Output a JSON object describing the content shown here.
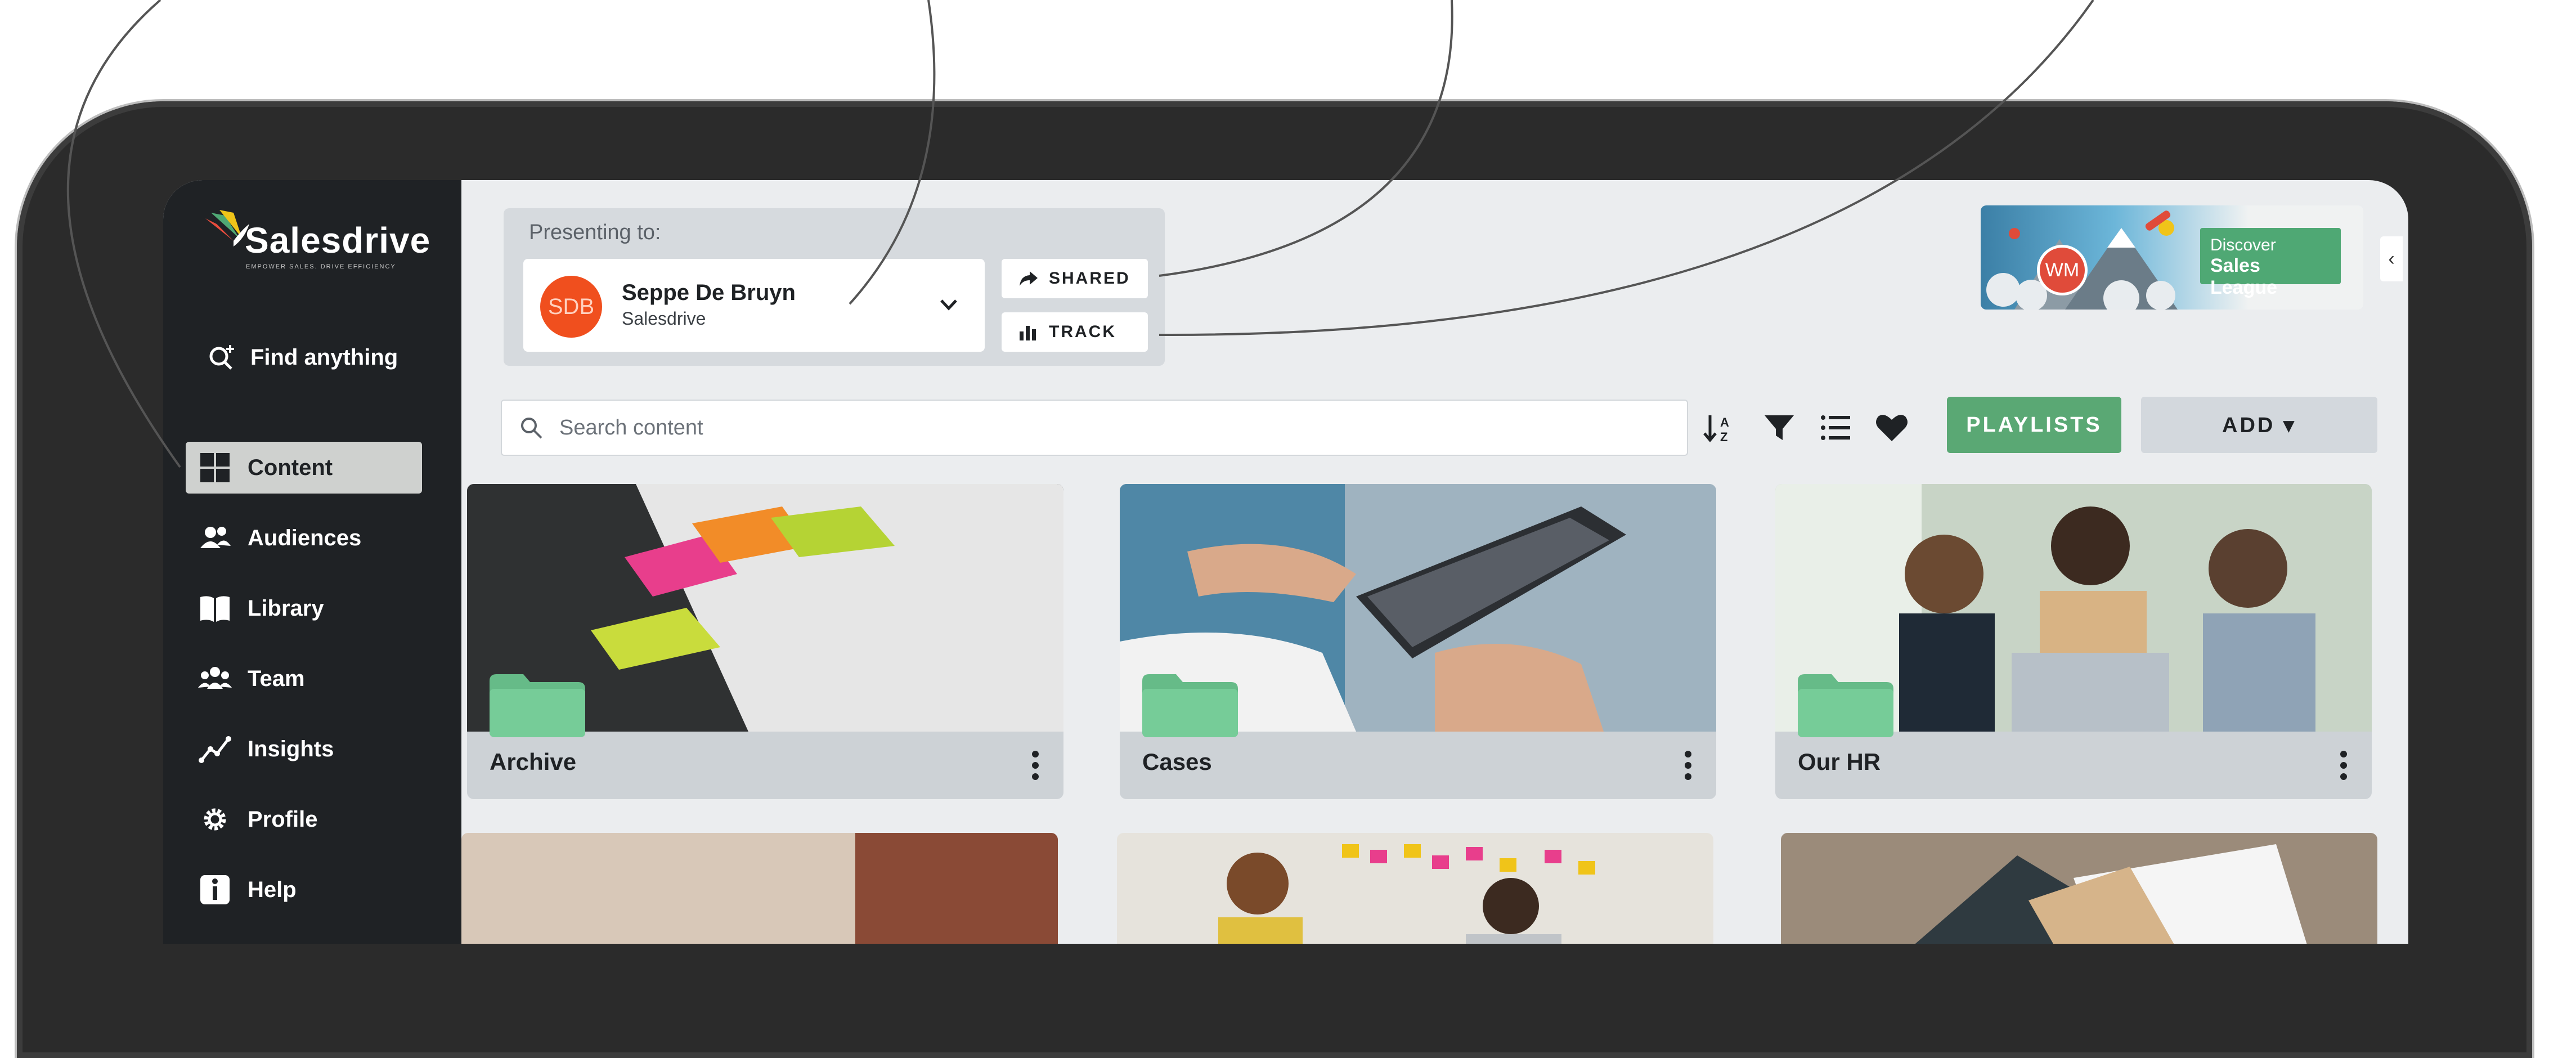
{
  "sidebar": {
    "logo_word": "Salesdrive",
    "logo_tagline": "EMPOWER SALES. DRIVE EFFICIENCY",
    "find": "Find anything",
    "items": [
      {
        "label": "Content",
        "icon": "grid-icon",
        "active": true
      },
      {
        "label": "Audiences",
        "icon": "users-icon",
        "active": false
      },
      {
        "label": "Library",
        "icon": "book-icon",
        "active": false
      },
      {
        "label": "Team",
        "icon": "team-icon",
        "active": false
      },
      {
        "label": "Insights",
        "icon": "chart-line-icon",
        "active": false
      },
      {
        "label": "Profile",
        "icon": "gear-icon",
        "active": false
      },
      {
        "label": "Help",
        "icon": "info-icon",
        "active": false
      }
    ]
  },
  "presenting": {
    "label": "Presenting to:",
    "initials": "SDB",
    "name": "Seppe De Bruyn",
    "organisation": "Salesdrive",
    "shared_label": "SHARED",
    "track_label": "TRACK"
  },
  "promo": {
    "line1": "Discover",
    "line2": "Sales League",
    "badge": "WM"
  },
  "toolbar": {
    "search_placeholder": "Search content",
    "playlists_label": "PLAYLISTS",
    "add_label": "ADD ▾"
  },
  "cards": [
    {
      "title": "Archive"
    },
    {
      "title": "Cases"
    },
    {
      "title": "Our HR"
    }
  ],
  "colors": {
    "sidebar_bg": "#1f2225",
    "accent_green": "#5aa874",
    "avatar_orange": "#f04f1e"
  }
}
